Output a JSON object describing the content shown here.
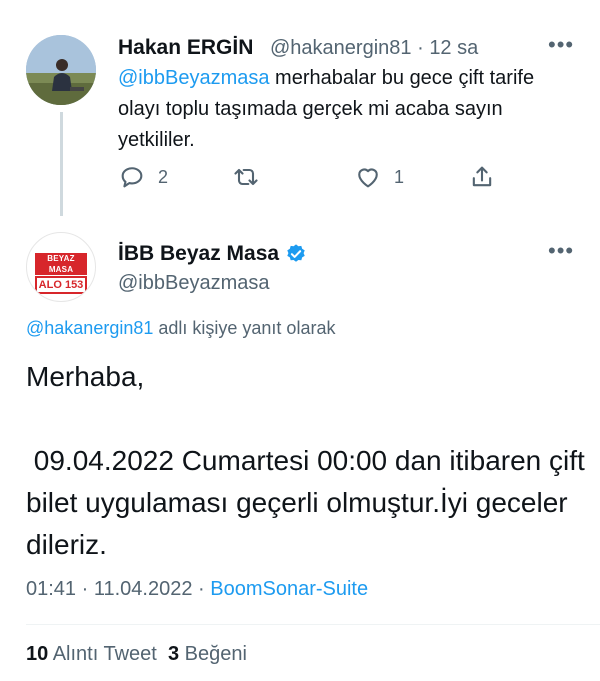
{
  "reply_tweet": {
    "author_name": "Hakan ERGİN",
    "handle": "@hakanergin81",
    "separator": "·",
    "time_ago": "12 sa",
    "mention": "@ibbBeyazmasa",
    "text": " merhabalar bu gece çift tarife olayı toplu taşımada gerçek mi acaba sayın yetkililer.",
    "reply_count": "2",
    "like_count": "1"
  },
  "main_tweet": {
    "author_name": "İBB Beyaz Masa",
    "handle": "@ibbBeyazmasa",
    "avatar_text_top": "BEYAZ MASA",
    "avatar_text_bottom": "ALO 153",
    "replying_to_handle": "@hakanergin81",
    "replying_suffix": " adlı kişiye yanıt olarak",
    "body": "Merhaba,\n\n 09.04.2022 Cumartesi 00:00 dan itibaren çift bilet uygulaması geçerli olmuştur.İyi geceler dileriz.",
    "time": "01:41",
    "date": "11.04.2022",
    "source": "BoomSonar-Suite",
    "quote_count": "10",
    "quote_label": "Alıntı Tweet",
    "like_count": "3",
    "like_label": "Beğeni"
  },
  "colors": {
    "accent": "#1d9bf0",
    "secondary_text": "#536471",
    "brand_red": "#d7262b"
  }
}
